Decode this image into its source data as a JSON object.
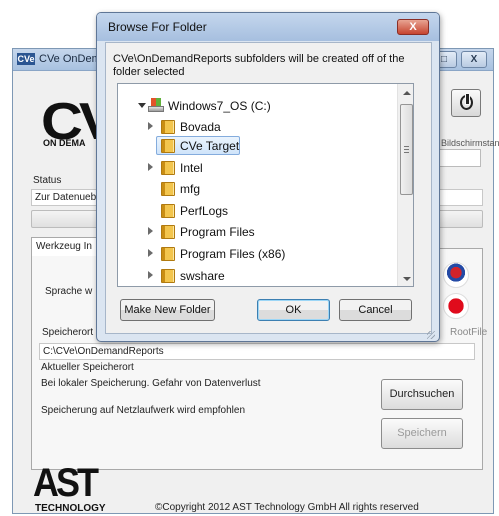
{
  "app": {
    "title": "CVe OnDemand",
    "title_icon": "CVe",
    "minimize": "–",
    "maximize": "□",
    "close": "X",
    "logo": "CV",
    "logo_sub": "ON DEMA",
    "nonscreen_label": "Bildschirmstand",
    "status_label": "Status",
    "status_value": "Zur Datenuebertragung",
    "tab_label": "Werkzeug In",
    "sprache_label": "Sprache w",
    "speicherort_label": "Speicherort",
    "rootfile_label": "RootFile",
    "path_value": "C:\\CVe\\OnDemandReports",
    "aktueller_label": "Aktueller Speicherort",
    "warning_label": "Bei lokaler Speicherung. Gefahr von Datenverlust",
    "netz_label": "Speicherung auf Netzlaufwerk wird empfohlen",
    "durchsuchen_label": "Durchsuchen",
    "speichern_label": "Speichern",
    "ast_logo": "AST",
    "ast_sub": "TECHNOLOGY",
    "copyright": "©Copyright 2012 AST Technology GmbH All rights reserved",
    "icons": [
      "power-icon",
      "flag-korea-icon",
      "flag-japan-icon"
    ]
  },
  "dialog": {
    "title": "Browse For Folder",
    "close": "X",
    "message": "CVe\\OnDemandReports subfolders will be created off of the folder selected",
    "tree": {
      "drive": "Windows7_OS (C:)",
      "folders": [
        {
          "label": "Bovada",
          "expandable": true,
          "selected": false
        },
        {
          "label": "CVe Target",
          "expandable": false,
          "selected": true
        },
        {
          "label": "Intel",
          "expandable": true,
          "selected": false
        },
        {
          "label": "mfg",
          "expandable": false,
          "selected": false
        },
        {
          "label": "PerfLogs",
          "expandable": false,
          "selected": false
        },
        {
          "label": "Program Files",
          "expandable": true,
          "selected": false
        },
        {
          "label": "Program Files (x86)",
          "expandable": true,
          "selected": false
        },
        {
          "label": "swshare",
          "expandable": false,
          "selected": false
        }
      ]
    },
    "buttons": {
      "make_new_folder": "Make New Folder",
      "ok": "OK",
      "cancel": "Cancel"
    }
  },
  "colors": {
    "titlebar": "#a8c2e0",
    "selection": "#cfe4fa",
    "close_red": "#c6442f",
    "folder": "#f3c54d"
  }
}
